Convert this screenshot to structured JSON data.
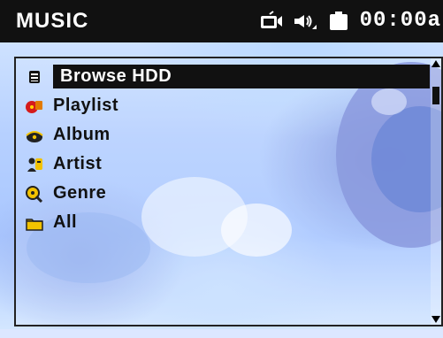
{
  "header": {
    "title": "MUSIC",
    "time": "00:00a",
    "icons": {
      "tv": "tv-output-icon",
      "volume": "volume-icon",
      "battery": "battery-icon"
    }
  },
  "menu": {
    "items": [
      {
        "label": "Browse HDD",
        "icon": "hard-drive-icon",
        "selected": true
      },
      {
        "label": "Playlist",
        "icon": "playlist-icon",
        "selected": false
      },
      {
        "label": "Album",
        "icon": "album-icon",
        "selected": false
      },
      {
        "label": "Artist",
        "icon": "artist-icon",
        "selected": false
      },
      {
        "label": "Genre",
        "icon": "genre-icon",
        "selected": false
      },
      {
        "label": "All",
        "icon": "all-folder-icon",
        "selected": false
      }
    ]
  }
}
